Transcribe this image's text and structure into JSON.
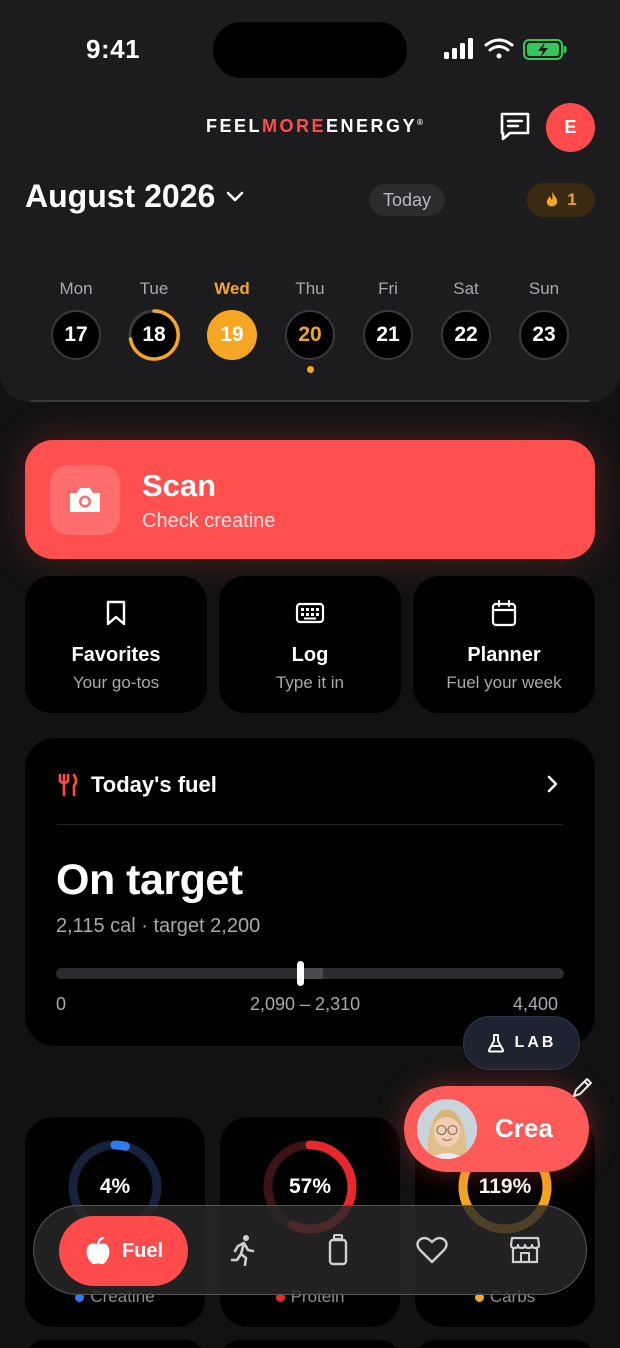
{
  "status_bar": {
    "time": "9:41"
  },
  "brand": {
    "part1": "FEEL",
    "part2": "MORE",
    "part3": "ENERGY",
    "mark": "®"
  },
  "header": {
    "avatar_initial": "E",
    "month": "August 2026",
    "today_label": "Today",
    "streak_count": "1"
  },
  "week": [
    {
      "name": "Mon",
      "num": "17"
    },
    {
      "name": "Tue",
      "num": "18"
    },
    {
      "name": "Wed",
      "num": "19"
    },
    {
      "name": "Thu",
      "num": "20"
    },
    {
      "name": "Fri",
      "num": "21"
    },
    {
      "name": "Sat",
      "num": "22"
    },
    {
      "name": "Sun",
      "num": "23"
    }
  ],
  "scan": {
    "title": "Scan",
    "subtitle": "Check creatine"
  },
  "tiles": [
    {
      "title": "Favorites",
      "subtitle": "Your go-tos",
      "icon": "bookmark-icon"
    },
    {
      "title": "Log",
      "subtitle": "Type it in",
      "icon": "keyboard-icon"
    },
    {
      "title": "Planner",
      "subtitle": "Fuel your week",
      "icon": "calendar-icon"
    }
  ],
  "fuel": {
    "title": "Today's fuel",
    "status": "On target",
    "calories_line": "2,115 cal · target 2,200",
    "scale_min": "0",
    "range_label": "2,090 – 2,310",
    "scale_max": "4,400",
    "calories": 2115,
    "range_low": 2090,
    "range_high": 2310,
    "max": 4400
  },
  "macros": [
    {
      "pct_label": "4%",
      "pct": 4,
      "name": "Creatine",
      "color": "#2f7bf6",
      "track": "#16213a"
    },
    {
      "pct_label": "57%",
      "pct": 57,
      "name": "Protein",
      "color": "#e8282b",
      "track": "#3a1414"
    },
    {
      "pct_label": "119%",
      "pct": 100,
      "name": "Carbs",
      "color": "#f5a623",
      "track": "#3a2a10"
    }
  ],
  "lab": {
    "label": "LAB"
  },
  "assistant": {
    "label": "Crea"
  },
  "tabbar": {
    "fuel_label": "Fuel"
  }
}
